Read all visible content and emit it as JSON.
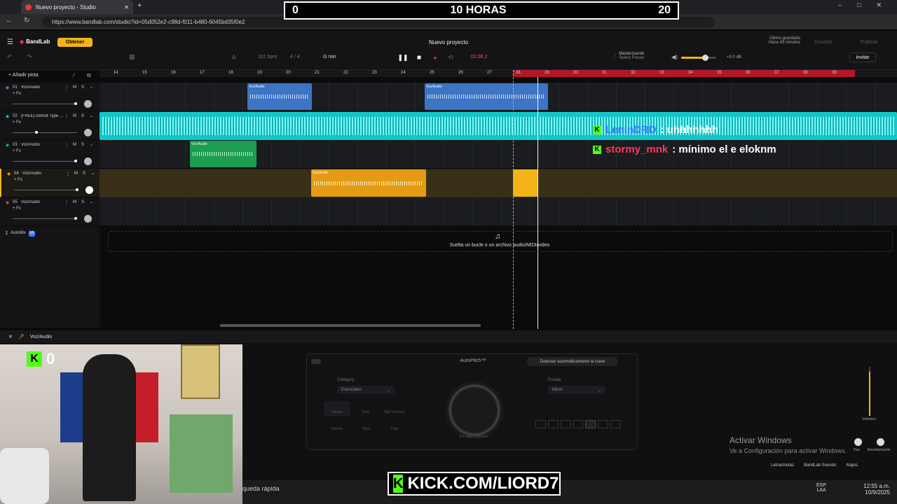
{
  "browser": {
    "tab_title": "Nuevo proyecto - Studio",
    "url": "https://www.bandlab.com/studio?id=05d052e2-c98d-f011-b480-6045bd35f0e2"
  },
  "overlay": {
    "left_value": "0",
    "center_text": "10 HORAS",
    "right_value": "20",
    "kick_count": "0",
    "kick_url": "KICK.COM/LIORD7"
  },
  "app": {
    "logo": "BandLab",
    "obtener_label": "Obtener",
    "project_title": "Nuevo proyecto",
    "saved_label": "Último guardado",
    "saved_time": "Hace 43 minutos",
    "save_label": "Guardar",
    "publish_label": "Publicar",
    "invite_label": "Invitar",
    "bpm": "101 bpm",
    "time_sig": "4 / 4",
    "key": "G min",
    "time_display": "01:06.2",
    "mastering_label": "Masterizando",
    "mastering_sub": "Select Preset",
    "volume_db": "+0.0 dB",
    "add_track": "Añadir pista",
    "drop_hint": "Suelta un bucle o un archivo audio/MIDI/video",
    "automix": "AutoMix",
    "automix_badge": "IA"
  },
  "ruler_marks": [
    "14",
    "15",
    "16",
    "17",
    "18",
    "19",
    "20",
    "21",
    "22",
    "23",
    "24",
    "25",
    "26",
    "27",
    "28",
    "29",
    "30",
    "31",
    "32",
    "33",
    "34",
    "35",
    "36",
    "37",
    "38",
    "39"
  ],
  "tracks": [
    {
      "num": "01",
      "name": "Voz/Audio",
      "color": "#4f8fe0"
    },
    {
      "num": "02",
      "name": "[FREE] Detroit Type ...",
      "color": "#18d2d6"
    },
    {
      "num": "03",
      "name": "Voz/Audio",
      "color": "#29c36a"
    },
    {
      "num": "04",
      "name": "Voz/Audio",
      "color": "#f0a81c"
    },
    {
      "num": "05",
      "name": "Voz/Audio",
      "color": "#e65050"
    }
  ],
  "track_common": {
    "fx": "+ Fx",
    "mute": "M",
    "solo": "S"
  },
  "clips": {
    "label": "Voz/Audio"
  },
  "chat": [
    {
      "user": "LeninDRD",
      "text": ": uhhhhhhh",
      "user_color": "#3a7bff"
    },
    {
      "user": "stormy_mnk",
      "text": ": mínimo el e eloknm",
      "user_color": "#ff3a5c"
    }
  ],
  "editor": {
    "track_label": "Voz/Audio",
    "autopitch": "AutoPitch™",
    "detect_key": "Detectar automáticamente la clave",
    "category_label": "Category",
    "category_value": "Esenciales",
    "scale_label": "Escala",
    "scale_value": "Minor",
    "knob_label": "Lo más intenso",
    "presets": [
      "Classic",
      "Duet",
      "Big Harmony",
      "Natural",
      "Tilted",
      "Chip"
    ],
    "volume_label": "Volumen",
    "reverb_label": "Reverberación",
    "pan_label": "Pan",
    "lyrics": "Letras/notas",
    "sounds": "BandLab Sounds",
    "shortcuts": "Atajos"
  },
  "windows": {
    "activate_title": "Activar Windows",
    "activate_sub": "Ve a Configuración para activar Windows.",
    "search": "queda rápida",
    "lang": "ESP",
    "lang2": "LAA",
    "time": "12:55 a.m.",
    "date": "10/9/2025"
  },
  "colors": {
    "accent": "#f2b418",
    "kick": "#53fc18",
    "red": "#b0182a"
  }
}
